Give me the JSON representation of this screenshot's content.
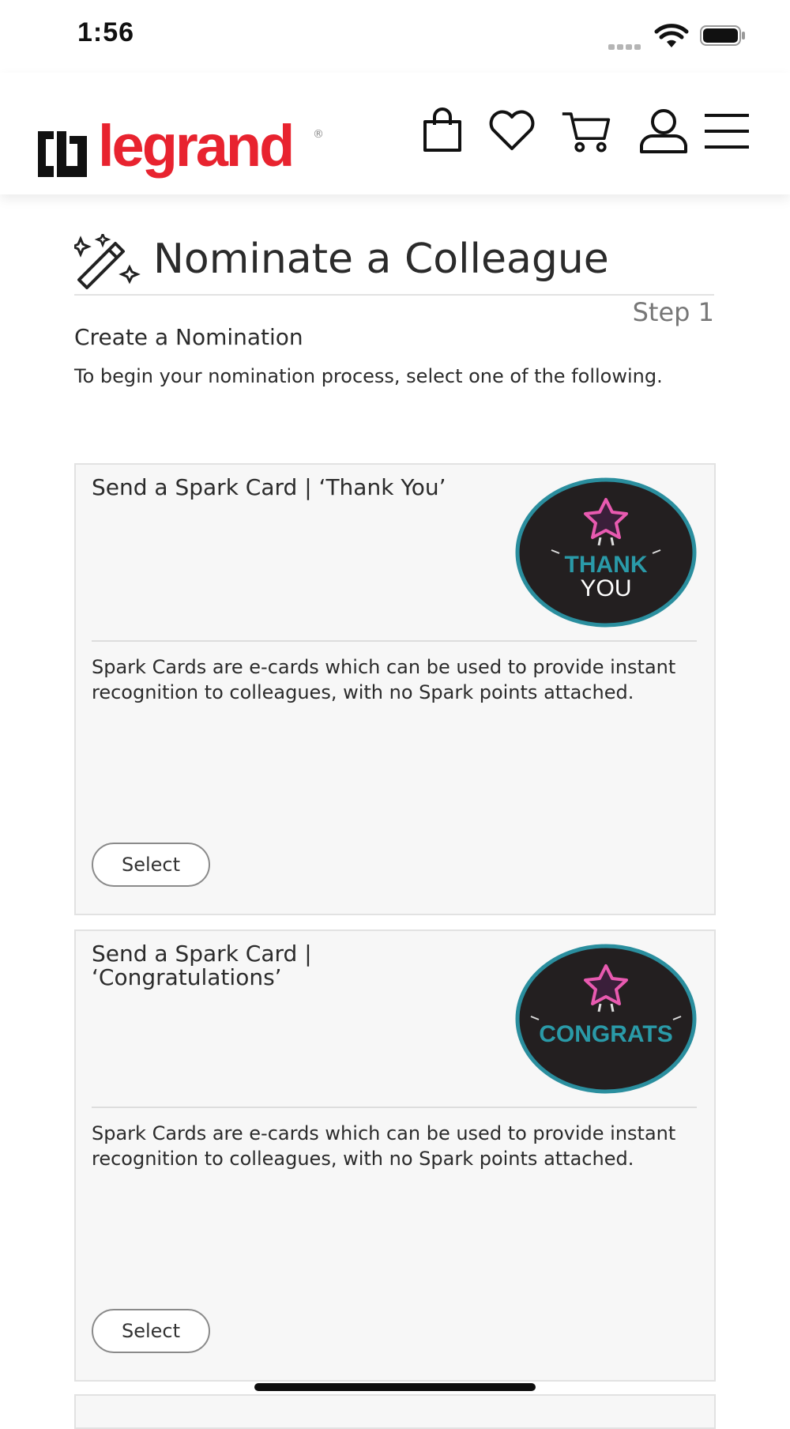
{
  "status": {
    "time": "1:56"
  },
  "brand": {
    "name": "legrand",
    "reg": "®"
  },
  "header_icons": [
    "shopping-bag-icon",
    "heart-icon",
    "cart-icon",
    "user-icon",
    "menu-icon"
  ],
  "page": {
    "title": "Nominate a Colleague",
    "step": "Step 1",
    "subheading": "Create a Nomination",
    "intro": "To begin your nomination process, select one of the following."
  },
  "cards": [
    {
      "title": "Send a Spark Card | ‘Thank You’",
      "badge_line1": "THANK",
      "badge_line2": "YOU",
      "description": "Spark Cards are e-cards which can be used to provide instant recognition to colleagues, with no Spark points attached.",
      "button": "Select"
    },
    {
      "title": "Send a Spark Card | ‘Congratulations’",
      "badge_line1": "CONGRATS",
      "badge_line2": "",
      "description": "Spark Cards are e-cards which can be used to provide instant recognition to colleagues, with no Spark points attached.",
      "button": "Select"
    }
  ],
  "colors": {
    "brand_red": "#e8232f",
    "badge_teal": "#2a8e9e",
    "badge_bg": "#231f20",
    "star_pink": "#e85ab0"
  }
}
